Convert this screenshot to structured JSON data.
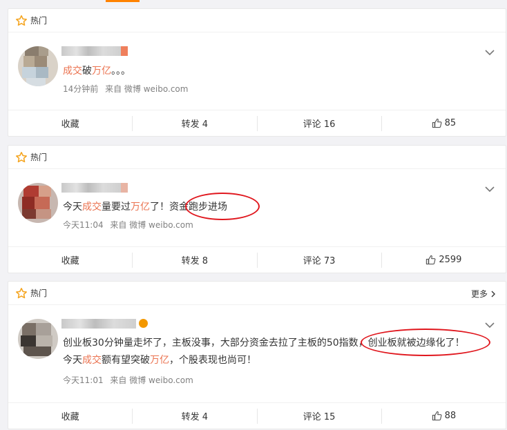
{
  "cards": [
    {
      "header": {
        "label": "热门",
        "more": null
      },
      "post": {
        "text": [
          {
            "t": "成交",
            "h": true
          },
          {
            "t": "破",
            "h": false
          },
          {
            "t": "万亿",
            "h": true
          },
          {
            "t": "。。。",
            "h": false
          }
        ],
        "text2": null,
        "time": "14分钟前",
        "source": "来自 微博 weibo.com"
      },
      "actions": {
        "favorite": "收藏",
        "repost": "转发 4",
        "comment": "评论 16",
        "like": "85"
      }
    },
    {
      "header": {
        "label": "热门",
        "more": null
      },
      "post": {
        "text": [
          {
            "t": "今天",
            "h": false
          },
          {
            "t": "成交",
            "h": true
          },
          {
            "t": "量要过",
            "h": false
          },
          {
            "t": "万亿",
            "h": true
          },
          {
            "t": "了！资金跑步进场",
            "h": false
          }
        ],
        "text2": null,
        "time": "今天11:04",
        "source": "来自 微博 weibo.com"
      },
      "actions": {
        "favorite": "收藏",
        "repost": "转发 8",
        "comment": "评论 73",
        "like": "2599"
      }
    },
    {
      "header": {
        "label": "热门",
        "more": "更多"
      },
      "post": {
        "text": [
          {
            "t": "创业板30分钟量走坏了，主板没事，大部分资金去拉了主板的50指数，创业板就被边缘化了！",
            "h": false
          }
        ],
        "text2": [
          {
            "t": "今天",
            "h": false
          },
          {
            "t": "成交",
            "h": true
          },
          {
            "t": "额有望突破",
            "h": false
          },
          {
            "t": "万亿",
            "h": true
          },
          {
            "t": "，个股表现也尚可！",
            "h": false
          }
        ],
        "time": "今天11:01",
        "source": "来自 微博 weibo.com"
      },
      "actions": {
        "favorite": "收藏",
        "repost": "转发 4",
        "comment": "评论 15",
        "like": "88"
      }
    }
  ],
  "colors": {
    "highlight": "#eb7350",
    "annotation": "#e0161d",
    "accent": "#ff8200"
  },
  "icons": {
    "hot": "star-outline-icon",
    "chevron": "chevron-down-icon",
    "like": "thumbs-up-icon",
    "more": "chevron-right-icon",
    "verified": "verified-badge-icon"
  }
}
